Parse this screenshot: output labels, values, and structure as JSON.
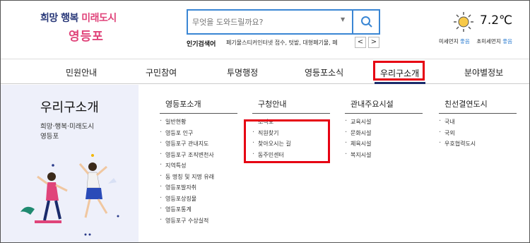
{
  "header": {
    "logo": {
      "line1_a": "희망",
      "line1_b": "행복",
      "line1_c": "미래도시",
      "line2": "영등포"
    },
    "search": {
      "placeholder": "무엇을 도와드릴까요?",
      "button_icon": "search-icon"
    },
    "popular": {
      "label": "인기검색어",
      "keywords": "폐기물스티커인터넷 접수, 텃밭, 대형폐기물, 폐",
      "prev": "<",
      "next": ">"
    },
    "weather": {
      "icon": "sun-icon",
      "temp": "7.2℃",
      "fine_dust_label": "미세먼지",
      "fine_dust_value": "좋음",
      "ultra_dust_label": "초미세먼지",
      "ultra_dust_value": "좋음"
    }
  },
  "nav": {
    "items": [
      "민원안내",
      "구민참여",
      "투명행정",
      "영등포소식",
      "우리구소개",
      "분야별정보"
    ],
    "active_index": 4
  },
  "side": {
    "title": "우리구소개",
    "sub1": "희망·행복·미래도시",
    "sub2": "영등포"
  },
  "menu": [
    {
      "head": "영등포소개",
      "items": [
        "일반현황",
        "영등포 인구",
        "영등포구 관내지도",
        "영등포구 조직변천사",
        "지역특성",
        "동 명칭 및 지명 유래",
        "영등포발자취",
        "영등포상징물",
        "영등포통계",
        "영등포구 수상실적"
      ]
    },
    {
      "head": "구청안내",
      "items": [
        "조직도",
        "직원찾기",
        "찾아오시는 길",
        "동주민센터"
      ]
    },
    {
      "head": "관내주요시설",
      "items": [
        "교육시설",
        "문화시설",
        "체육시설",
        "복지시설"
      ]
    },
    {
      "head": "친선결연도시",
      "items": [
        "국내",
        "국외",
        "우호협력도시"
      ]
    }
  ],
  "colors": {
    "accent": "#3a86d4",
    "highlight": "#e60012",
    "navy": "#1a2b6b",
    "pink": "#e0447a",
    "side_bg": "#eef0fa"
  }
}
